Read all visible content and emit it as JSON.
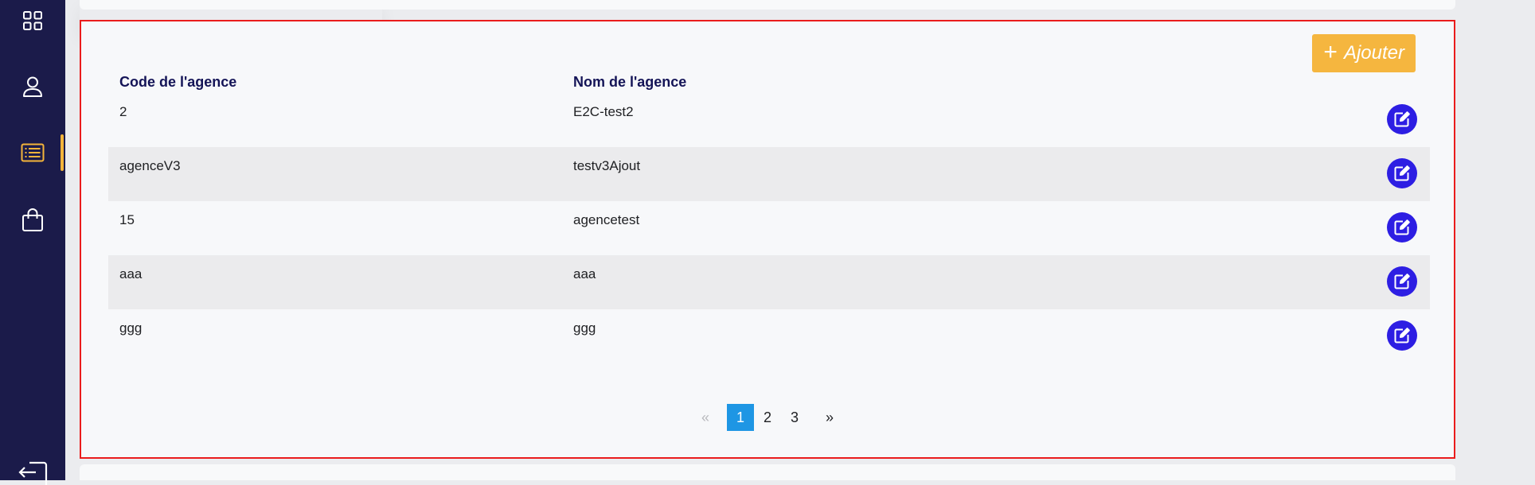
{
  "sidebar": {
    "items": [
      {
        "name": "dashboard",
        "icon": "grid-icon"
      },
      {
        "name": "users",
        "icon": "user-icon"
      },
      {
        "name": "agencies",
        "icon": "list-icon",
        "active": true
      },
      {
        "name": "products",
        "icon": "bag-icon"
      }
    ],
    "logout_icon": "logout-icon",
    "active_color": "#f4b43a",
    "background": "#1b1b4a"
  },
  "toolbar": {
    "add_label": "Ajouter",
    "add_icon": "plus-icon",
    "add_color": "#f5b63f"
  },
  "table": {
    "columns": [
      "Code de l'agence",
      "Nom de l'agence"
    ],
    "rows": [
      {
        "code": "2",
        "name": "E2C-test2"
      },
      {
        "code": "agenceV3",
        "name": "testv3Ajout"
      },
      {
        "code": "15",
        "name": "agencetest"
      },
      {
        "code": "aaa",
        "name": "aaa"
      },
      {
        "code": "ggg",
        "name": "ggg"
      }
    ],
    "edit_icon": "edit-icon",
    "edit_color": "#2d1ee3"
  },
  "pagination": {
    "prev": "«",
    "pages": [
      "1",
      "2",
      "3"
    ],
    "current": "1",
    "next": "»",
    "active_color": "#1e96e4"
  }
}
